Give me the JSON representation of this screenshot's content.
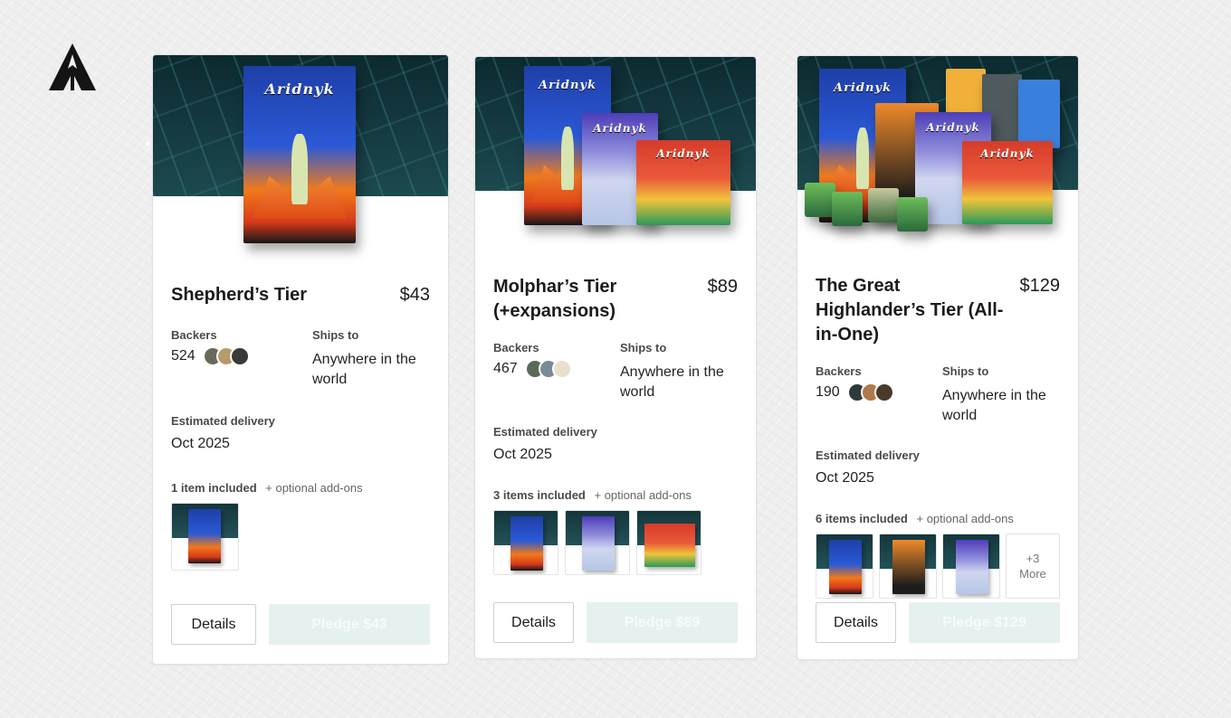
{
  "brand": {
    "logo_icon": "spearhead-logo-icon"
  },
  "colors": {
    "pledge_bg": "#e5f1ee",
    "pledge_text": "#f6fbfa",
    "hero_dark": "#0c2a30"
  },
  "labels": {
    "backers": "Backers",
    "ships_to": "Ships to",
    "estimated_delivery": "Estimated delivery",
    "optional_addons": "+ optional add-ons",
    "details": "Details"
  },
  "tiers": [
    {
      "title": "Shepherd’s Tier",
      "price": "$43",
      "backers": "524",
      "ships_to": "Anywhere in the world",
      "delivery": "Oct 2025",
      "items_count": "1 item included",
      "pledge_label": "Pledge $43",
      "avatars": [
        "#6a6a5a",
        "#b59a6a",
        "#3b3a3a"
      ]
    },
    {
      "title": "Molphar’s Tier (+expansions)",
      "price": "$89",
      "backers": "467",
      "ships_to": "Anywhere in the world",
      "delivery": "Oct 2025",
      "items_count": "3 items included",
      "pledge_label": "Pledge $89",
      "avatars": [
        "#5a6a5a",
        "#7a8a96",
        "#e8e0cc"
      ]
    },
    {
      "title": "The Great Highlander’s Tier (All-in-One)",
      "price": "$129",
      "backers": "190",
      "ships_to": "Anywhere in the world",
      "delivery": "Oct 2025",
      "items_count": "6 items included",
      "pledge_label": "Pledge $129",
      "more_count": "+3",
      "more_label": "More",
      "avatars": [
        "#2e3a3a",
        "#b0794a",
        "#4a3a2a"
      ]
    }
  ]
}
